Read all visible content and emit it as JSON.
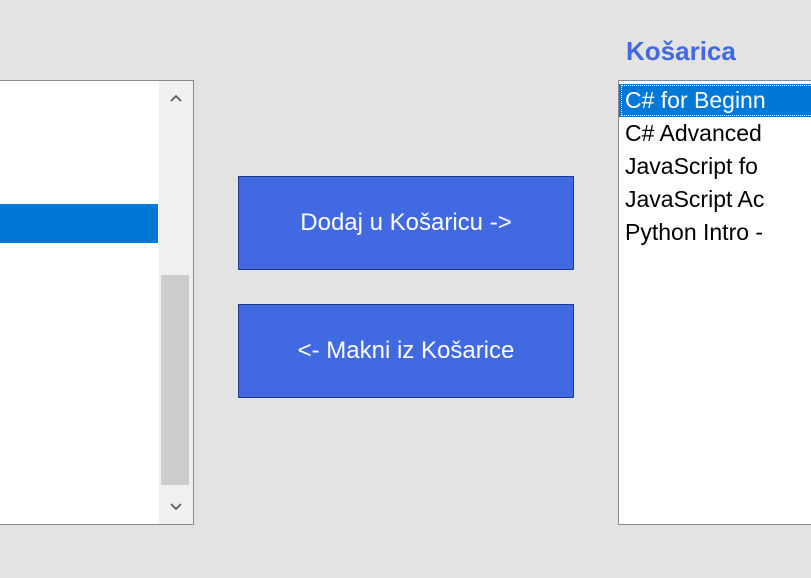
{
  "colors": {
    "accent": "#4169e1",
    "selection": "#0078d7",
    "background": "#e3e3e3"
  },
  "left_list": {
    "items": [],
    "scrollbar": {
      "up_icon": "chevron-up-icon",
      "down_icon": "chevron-down-icon",
      "scroll_position": 0.75
    }
  },
  "buttons": {
    "add_label": "Dodaj u Košaricu ->",
    "remove_label": "<- Makni iz Košarice"
  },
  "cart": {
    "label": "Košarica",
    "items": [
      {
        "label": "C# for Beginn",
        "selected": true
      },
      {
        "label": "C# Advanced",
        "selected": false
      },
      {
        "label": "JavaScript fo",
        "selected": false
      },
      {
        "label": "JavaScript Ac",
        "selected": false
      },
      {
        "label": "Python Intro -",
        "selected": false
      }
    ]
  }
}
